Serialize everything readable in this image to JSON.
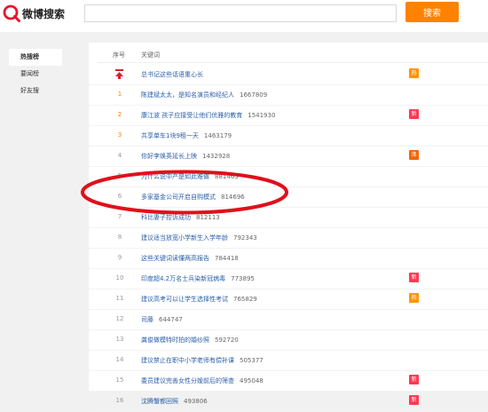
{
  "header": {
    "logo_text": "微博搜索",
    "search_placeholder": "",
    "search_button": "搜索"
  },
  "sidebar": {
    "items": [
      {
        "label": "热搜榜",
        "active": true
      },
      {
        "label": "要闻榜",
        "active": false
      },
      {
        "label": "好友搜",
        "active": false
      }
    ]
  },
  "table": {
    "col_rank": "序号",
    "col_keyword": "关键词",
    "rows": [
      {
        "rank": "",
        "pinned": true,
        "keyword": "总书记这些话语重心长",
        "count": "",
        "badge": "热",
        "badge_color": "#ff9406"
      },
      {
        "rank": "1",
        "keyword": "陈建斌太太，是知名演员和经纪人",
        "count": "1667809",
        "badge": "",
        "badge_color": ""
      },
      {
        "rank": "2",
        "keyword": "康江波 孩子应接受让他们优雅的教育",
        "count": "1541930",
        "badge": "新",
        "badge_color": "#ff3852"
      },
      {
        "rank": "3",
        "keyword": "共享单车1块9租一天",
        "count": "1463179",
        "badge": "",
        "badge_color": ""
      },
      {
        "rank": "4",
        "keyword": "你好李焕英延长上映",
        "count": "1432928",
        "badge": "沸",
        "badge_color": "#f86400"
      },
      {
        "rank": "5",
        "keyword": "为什么说中产是如此难做",
        "count": "881463",
        "badge": "",
        "badge_color": ""
      },
      {
        "rank": "6",
        "keyword": "多家基金公司开启自购模式",
        "count": "814696",
        "badge": "",
        "badge_color": ""
      },
      {
        "rank": "7",
        "keyword": "科比妻子控诉成功",
        "count": "812113",
        "badge": "",
        "badge_color": ""
      },
      {
        "rank": "8",
        "keyword": "建议适当放宽小学新生入学年龄",
        "count": "792343",
        "badge": "",
        "badge_color": ""
      },
      {
        "rank": "9",
        "keyword": "这些关键词读懂两高报告",
        "count": "784418",
        "badge": "",
        "badge_color": ""
      },
      {
        "rank": "10",
        "keyword": "印度超4.2万名士兵染新冠病毒",
        "count": "773895",
        "badge": "新",
        "badge_color": "#ff3852"
      },
      {
        "rank": "11",
        "keyword": "建议高考可以让学生选择性考试",
        "count": "765829",
        "badge": "热",
        "badge_color": "#ff9406"
      },
      {
        "rank": "12",
        "keyword": "司藤",
        "count": "644747",
        "badge": "",
        "badge_color": ""
      },
      {
        "rank": "13",
        "keyword": "龚俊做模特时拍的婚纱照",
        "count": "592720",
        "badge": "",
        "badge_color": ""
      },
      {
        "rank": "14",
        "keyword": "建议禁止在职中小学老师有偿补课",
        "count": "505377",
        "badge": "",
        "badge_color": ""
      },
      {
        "rank": "15",
        "keyword": "委员建议完善女性分娩前后的筛查",
        "count": "495048",
        "badge": "新",
        "badge_color": "#ff3852"
      },
      {
        "rank": "16",
        "keyword": "沈腾蟹都回照",
        "count": "493806",
        "badge": "新",
        "badge_color": "#ff3852"
      }
    ]
  },
  "colors": {
    "accent": "#ff8200",
    "link": "#2a5ea8",
    "annotation": "#e0101a"
  }
}
